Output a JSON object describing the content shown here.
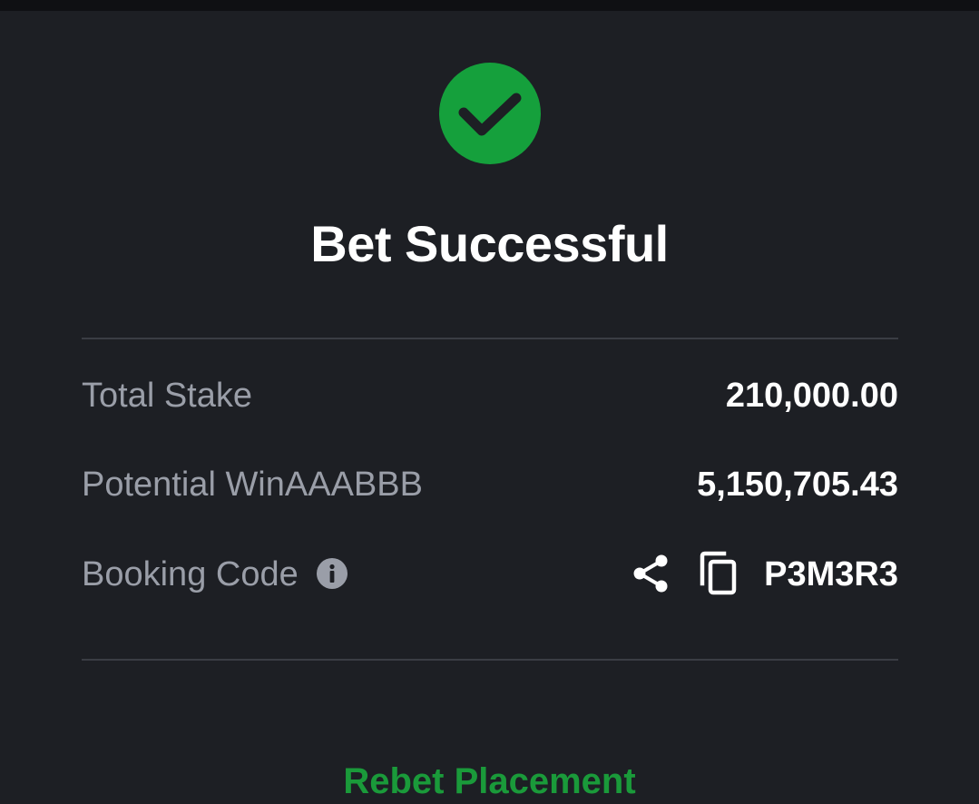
{
  "dialog": {
    "title": "Bet Successful",
    "status_color": "#15a03c",
    "icons": {
      "success": "check-circle-icon",
      "info": "info-icon",
      "share": "share-icon",
      "copy": "copy-icon"
    }
  },
  "summary": {
    "total_stake": {
      "label": "Total Stake",
      "value": "210,000.00"
    },
    "potential_win": {
      "label": "Potential WinAAABBB",
      "value": "5,150,705.43"
    },
    "booking_code": {
      "label": "Booking Code",
      "value": "P3M3R3"
    }
  },
  "footer": {
    "link_label": "Rebet Placement"
  }
}
